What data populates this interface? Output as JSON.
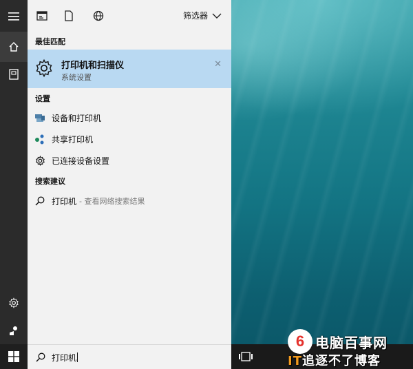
{
  "filter": {
    "label": "筛选器"
  },
  "sections": {
    "best_match": "最佳匹配",
    "settings": "设置",
    "suggestions": "搜索建议"
  },
  "best_match": {
    "title": "打印机和扫描仪",
    "subtitle": "系统设置",
    "icon": "gear-icon"
  },
  "settings_items": [
    {
      "label": "设备和打印机",
      "icon": "devices-printers-icon"
    },
    {
      "label": "共享打印机",
      "icon": "share-icon"
    },
    {
      "label": "已连接设备设置",
      "icon": "gear-icon"
    }
  ],
  "suggestion": {
    "label": "打印机",
    "hint": "- 查看网络搜索结果",
    "icon": "search-icon"
  },
  "search": {
    "query": "打印机"
  },
  "watermark": {
    "brand": "电脑百事网",
    "line2_prefix": "IT",
    "line2_text": "追逐不了博客",
    "logo_letter": "6"
  },
  "colors": {
    "selected": "#b9d9f2",
    "sidebar": "#2b2b2b",
    "panel": "#f2f2f2",
    "taskbar": "#1a1a1a"
  }
}
